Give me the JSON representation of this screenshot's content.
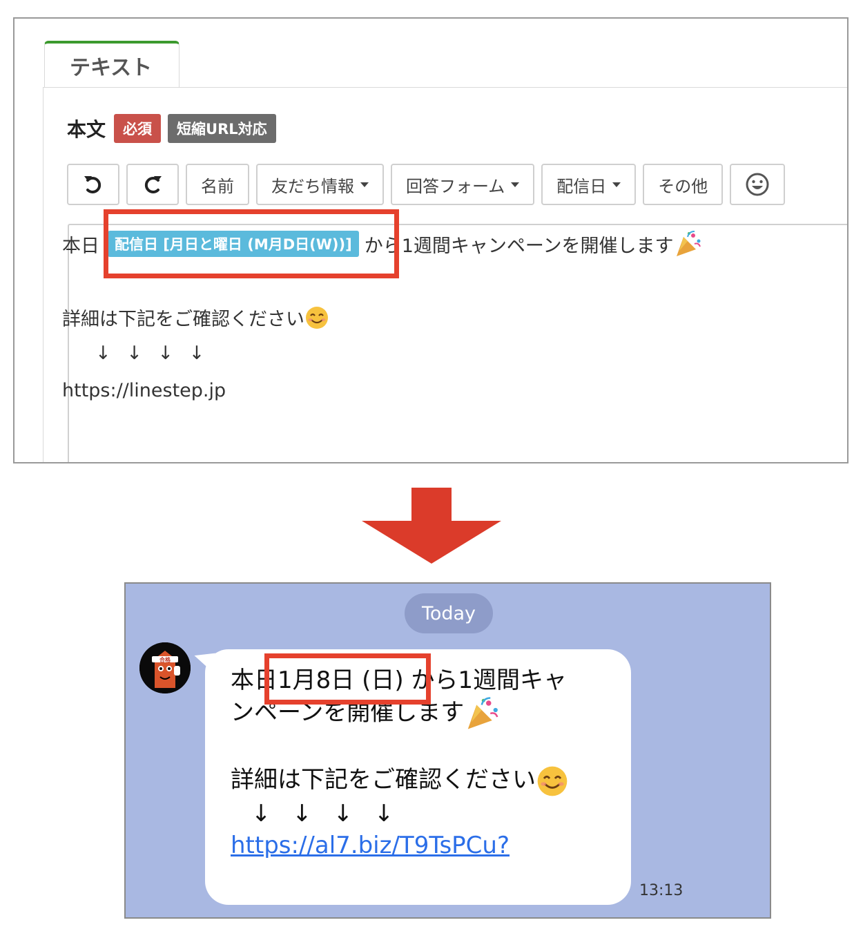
{
  "editor": {
    "tab_label": "テキスト",
    "field_title": "本文",
    "badge_required": "必須",
    "badge_url": "短縮URL対応",
    "toolbar": {
      "undo_icon": "undo-icon",
      "redo_icon": "redo-icon",
      "name": "名前",
      "friend_info": "友だち情報",
      "answer_form": "回答フォーム",
      "delivery_date": "配信日",
      "other": "その他",
      "emoji_icon": "smiley-icon"
    },
    "text": {
      "line1_prefix": "本日",
      "chip": "配信日 [月日と曜日 (M月D日(W))]",
      "line1_suffix": "から1週間キャンペーンを開催します",
      "line2": "詳細は下記をご確認ください",
      "arrows": "↓ ↓ ↓ ↓",
      "url": "https://linestep.jp"
    },
    "highlight_color": "#e5412d",
    "chip_color": "#5bbadc"
  },
  "chat": {
    "date_separator": "Today",
    "avatar_text": "合格",
    "message": {
      "line1": "本日1月8日 (日) から1週間キャ",
      "line2": "ンペーンを開催します",
      "line3": "詳細は下記をご確認ください",
      "arrows": "↓ ↓ ↓ ↓",
      "link": "https://al7.biz/T9TsPCu?"
    },
    "time": "13:13",
    "background_color": "#a9b8e2"
  }
}
